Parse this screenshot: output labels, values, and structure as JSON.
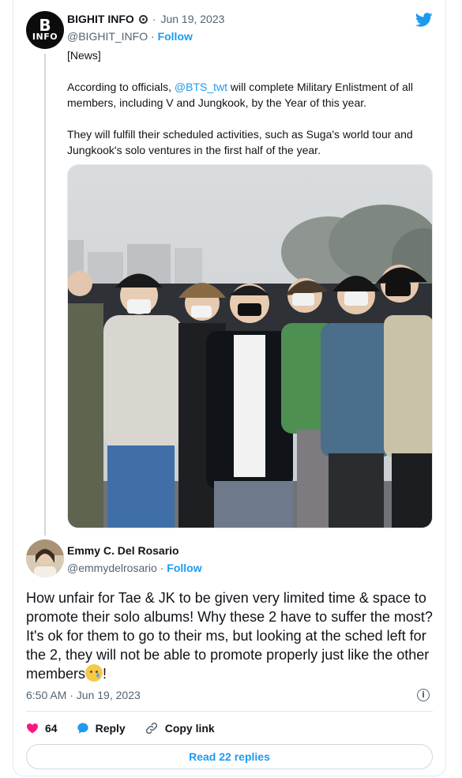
{
  "parent_tweet": {
    "avatar_text_top": "B",
    "avatar_text_bottom": "INFO",
    "name": "BIGHIT INFO",
    "date_separator": "·",
    "date": "Jun 19, 2023",
    "handle": "@BIGHIT_INFO",
    "handle_separator": "·",
    "follow_label": "Follow",
    "text_line_1": "[News]",
    "text_p2_before": "According to officials, ",
    "text_p2_mention": "@BTS_twt",
    "text_p2_after": " will complete Military Enlistment of all members, including V and Jungkook, by the Year of this year.",
    "text_p3": "They will fulfill their scheduled activities, such as Suga's world tour and Jungkook's solo ventures in the first half of the year."
  },
  "reply_tweet": {
    "name": "Emmy C. Del Rosario",
    "handle": "@emmydelrosario",
    "handle_separator": "·",
    "follow_label": "Follow",
    "text": "How unfair for Tae & JK to be given very limited time & space to promote their solo albums! Why these 2 have to suffer the most? It's ok for them to go to their ms, but looking at the sched left for the 2, they will not be able to promote properly just like the other members",
    "text_end": "!",
    "timestamp": "6:50 AM · Jun 19, 2023"
  },
  "actions": {
    "like_count": "64",
    "reply_label": "Reply",
    "copy_label": "Copy link"
  },
  "read_replies_label": "Read 22 replies",
  "colors": {
    "accent": "#1d9bf0",
    "like": "#f91880",
    "secondary_text": "#536471"
  },
  "icons": {
    "verified": "verified-badge-icon",
    "twitter": "twitter-bird-icon",
    "info": "info-icon",
    "like": "heart-icon",
    "reply": "reply-bubble-icon",
    "copy": "link-icon"
  }
}
